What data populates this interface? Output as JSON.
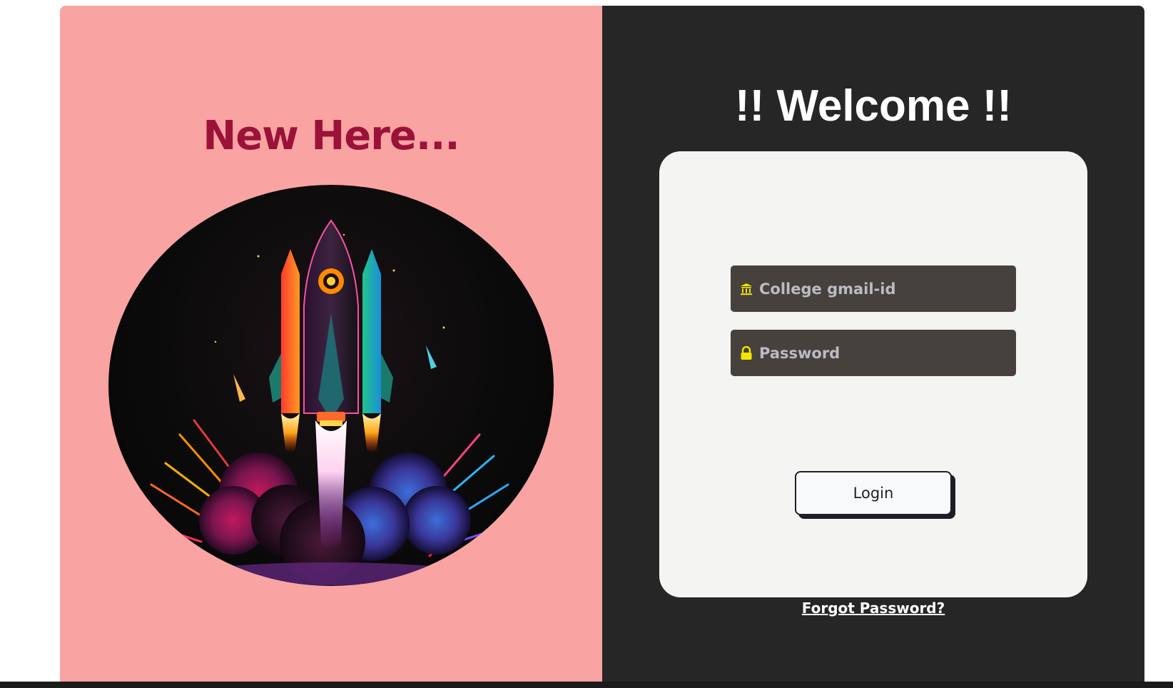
{
  "left_panel": {
    "heading": "New Here..."
  },
  "right_panel": {
    "heading": "!! Welcome !!",
    "form": {
      "email_placeholder": "College gmail-id",
      "password_placeholder": "Password",
      "email_icon": "bank-icon",
      "password_icon": "lock-icon",
      "icon_color": "#f2e600",
      "login_label": "Login"
    },
    "forgot_link": "Forgot Password?"
  },
  "colors": {
    "left_background": "#f9a3a3",
    "heading_accent": "#9b1238",
    "right_background": "#262626",
    "card_background": "#f4f4f2",
    "field_background": "#46413c"
  }
}
